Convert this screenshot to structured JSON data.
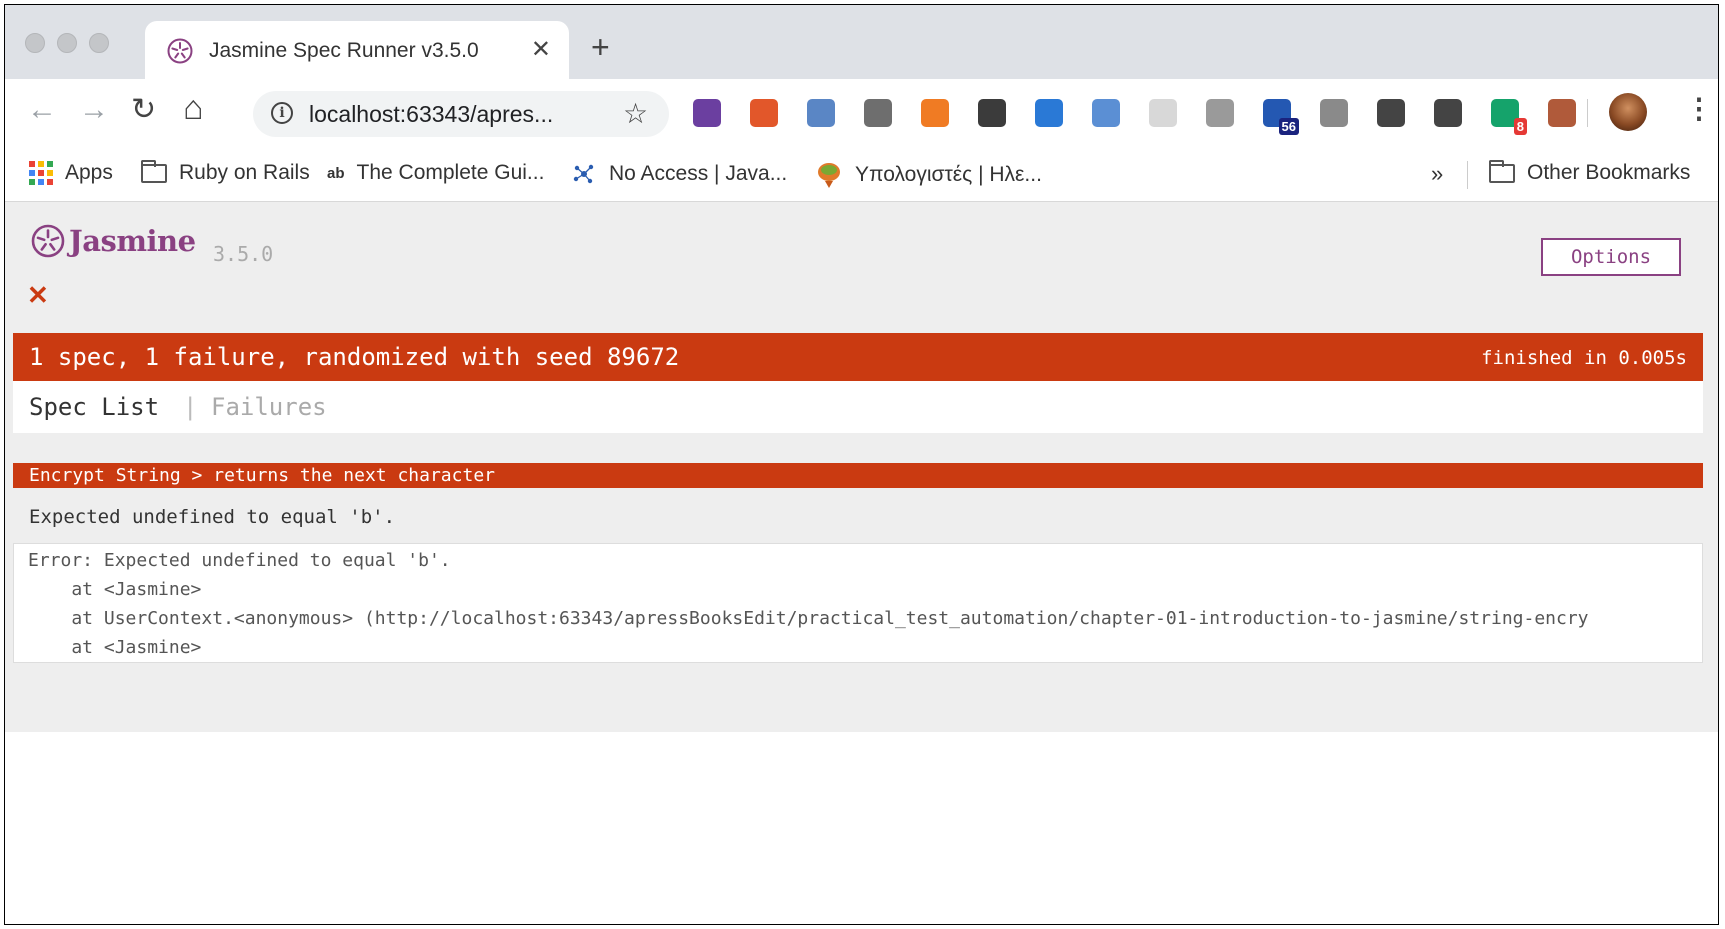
{
  "browser": {
    "tab": {
      "title": "Jasmine Spec Runner v3.5.0",
      "close_glyph": "✕"
    },
    "new_tab_glyph": "+",
    "omnibox": {
      "url": "localhost:63343/apres..."
    },
    "nav": {
      "back": "←",
      "forward": "→",
      "reload": "↻",
      "home": "⌂",
      "star": "☆",
      "more": "⋮"
    },
    "extensions": [
      {
        "name": "eyedropper-extension-icon",
        "color": "#6b3fa0",
        "badge": ""
      },
      {
        "name": "network-extension-icon",
        "color": "#e2572a",
        "badge": ""
      },
      {
        "name": "opera-extension-icon",
        "color": "#5a86c5",
        "badge": ""
      },
      {
        "name": "c-extension-icon",
        "color": "#6e6e6e",
        "badge": ""
      },
      {
        "name": "target-extension-icon",
        "color": "#f07b23",
        "badge": ""
      },
      {
        "name": "bulb-extension-icon",
        "color": "#3b3b3b",
        "badge": ""
      },
      {
        "name": "download-extension-icon",
        "color": "#2a79d6",
        "badge": ""
      },
      {
        "name": "window-extension-icon",
        "color": "#5b8fd4",
        "badge": ""
      },
      {
        "name": "react-extension-icon",
        "color": "#d8d8d8",
        "badge": ""
      },
      {
        "name": "chat-extension-icon",
        "color": "#9a9a9a",
        "badge": ""
      },
      {
        "name": "cloud-extension-icon",
        "color": "#2458b2",
        "badge": "56"
      },
      {
        "name": "globe-extension-icon",
        "color": "#8a8a8a",
        "badge": ""
      },
      {
        "name": "a-circle-extension-icon",
        "color": "#444444",
        "badge": ""
      },
      {
        "name": "move-extension-icon",
        "color": "#444444",
        "badge": ""
      },
      {
        "name": "grammarly-extension-icon",
        "color": "#15a36b",
        "badge": "8"
      },
      {
        "name": "cast-extension-icon",
        "color": "#b05a3a",
        "badge": ""
      }
    ],
    "bookmarks": [
      {
        "label": "Apps",
        "icon": "apps-grid-icon"
      },
      {
        "label": "Ruby on Rails",
        "icon": "folder-icon"
      },
      {
        "label": "The Complete Gui...",
        "icon": "ab-icon"
      },
      {
        "label": "No Access | Java...",
        "icon": "molecule-icon"
      },
      {
        "label": "Υπολογιστές | Ηλε...",
        "icon": "balloon-icon"
      }
    ],
    "bookmarks_overflow": "»",
    "other_bookmarks": "Other Bookmarks"
  },
  "jasmine": {
    "logo_text": "Jasmine",
    "version": "3.5.0",
    "options_label": "Options",
    "status_glyph": "✕",
    "summary": "1 spec, 1 failure, randomized with seed 89672",
    "duration": "finished in 0.005s",
    "menu": {
      "spec_list": "Spec List",
      "separator": "|",
      "failures": "Failures"
    },
    "failure": {
      "spec_name": "Encrypt String > returns the next character",
      "message": "Expected undefined to equal 'b'.",
      "stack": [
        "Error: Expected undefined to equal 'b'.",
        "    at <Jasmine>",
        "    at UserContext.<anonymous> (http://localhost:63343/apressBooksEdit/practical_test_automation/chapter-01-introduction-to-jasmine/string-encry",
        "    at <Jasmine>"
      ]
    }
  },
  "colors": {
    "failure_red": "#ca3a11",
    "jasmine_purple": "#8a4182",
    "tab_strip": "#dee1e6",
    "page_background": "#eeeeee"
  }
}
